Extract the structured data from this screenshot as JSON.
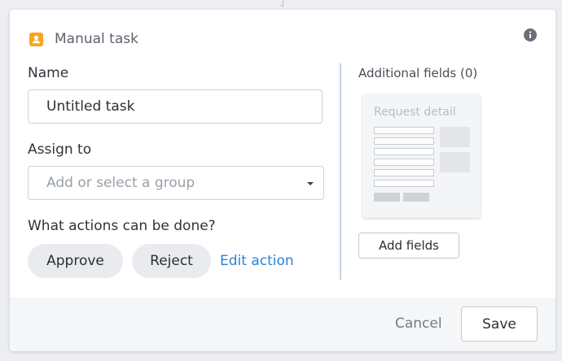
{
  "header": {
    "title": "Manual task",
    "icon": "person-icon",
    "accent_color": "#f5a623"
  },
  "form": {
    "name_label": "Name",
    "name_value": "Untitled task",
    "assign_label": "Assign to",
    "assign_placeholder": "Add or select a group",
    "actions_label": "What actions can be done?",
    "actions": [
      "Approve",
      "Reject"
    ],
    "edit_action_label": "Edit action",
    "link_color": "#2a82d8"
  },
  "additional": {
    "label": "Additional fields (0)",
    "preview_title": "Request detail",
    "add_fields_label": "Add fields"
  },
  "footer": {
    "cancel_label": "Cancel",
    "save_label": "Save"
  }
}
